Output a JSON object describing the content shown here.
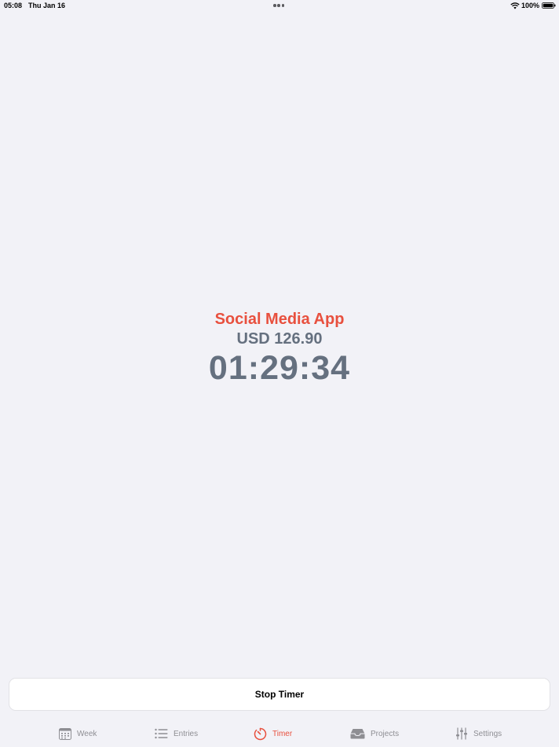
{
  "status_bar": {
    "time": "05:08",
    "date": "Thu Jan 16",
    "battery": "100%"
  },
  "timer": {
    "project_name": "Social Media App",
    "amount": "USD 126.90",
    "elapsed": "01:29:34"
  },
  "actions": {
    "stop_label": "Stop Timer"
  },
  "tabs": [
    {
      "label": "Week",
      "icon": "calendar-icon",
      "active": false
    },
    {
      "label": "Entries",
      "icon": "list-icon",
      "active": false
    },
    {
      "label": "Timer",
      "icon": "timer-icon",
      "active": true
    },
    {
      "label": "Projects",
      "icon": "tray-icon",
      "active": false
    },
    {
      "label": "Settings",
      "icon": "sliders-icon",
      "active": false
    }
  ],
  "colors": {
    "accent": "#e8503e",
    "text_secondary": "#65707f",
    "tab_inactive": "#8e8e93",
    "background": "#f2f2f7"
  }
}
